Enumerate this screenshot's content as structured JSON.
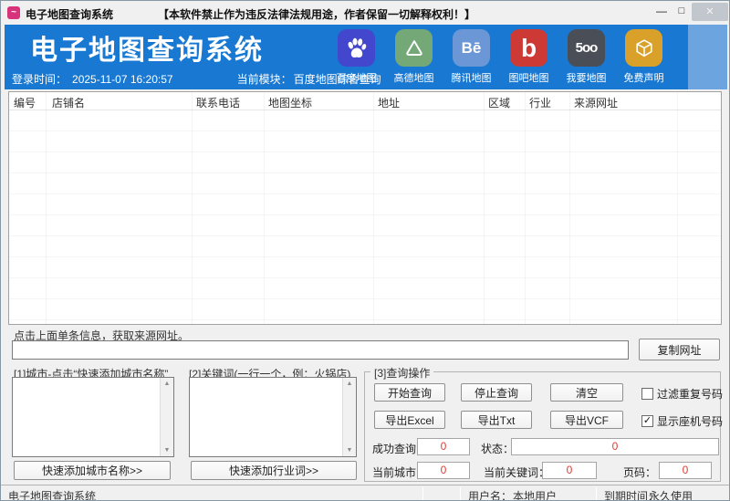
{
  "titlebar": {
    "title": "电子地图查询系统",
    "warning": "【本软件禁止作为违反法律法规用途，作者保留一切解释权利！】",
    "minimize": "—",
    "maximize": "□",
    "close": "✕"
  },
  "header": {
    "app_title": "电子地图查询系统",
    "login_time_label": "登录时间：",
    "login_time_value": "2025-11-07 16:20:57",
    "module_label": "当前模块：",
    "module_value": "百度地图综合查询",
    "shortcuts": [
      {
        "icon": "baidu-paw-icon",
        "label": "百度地图",
        "glyph": "",
        "color": "#4247ce"
      },
      {
        "icon": "mountain-icon",
        "label": "高德地图",
        "glyph": "",
        "color": "#74a877"
      },
      {
        "icon": "behance-icon",
        "label": "腾讯地图",
        "glyph": "Bē",
        "color": "#6b97d6"
      },
      {
        "icon": "letter-b-icon",
        "label": "图吧地图",
        "glyph": "b",
        "color": "#cd3a35"
      },
      {
        "icon": "500px-icon",
        "label": "我要地图",
        "glyph": "5oo",
        "color": "#4a4e56"
      },
      {
        "icon": "cube-icon",
        "label": "免费声明",
        "glyph": "",
        "color": "#d9a02a"
      }
    ]
  },
  "table": {
    "columns": [
      {
        "label": "编号"
      },
      {
        "label": "店铺名"
      },
      {
        "label": "联系电话"
      },
      {
        "label": "地图坐标"
      },
      {
        "label": "地址"
      },
      {
        "label": "区域"
      },
      {
        "label": "行业"
      },
      {
        "label": "来源网址"
      }
    ]
  },
  "url_section": {
    "hint": "点击上面单条信息，获取来源网址。",
    "url_value": "",
    "copy_button": "复制网址"
  },
  "city_panel": {
    "title": "[1]城市-点击“快速添加城市名称”",
    "list_value": "",
    "add_button": "快速添加城市名称>>"
  },
  "keyword_panel": {
    "title": "[2]关键词(一行一个，例：火锅店)",
    "list_value": "",
    "add_button": "快速添加行业词>>"
  },
  "query_panel": {
    "title": "[3]查询操作",
    "start_button": "开始查询",
    "stop_button": "停止查询",
    "clear_button": "清空",
    "export_excel_button": "导出Excel",
    "export_txt_button": "导出Txt",
    "export_vcf_button": "导出VCF",
    "filter_checkbox": {
      "label": "过滤重复号码",
      "checked": false,
      "mark": ""
    },
    "landline_checkbox": {
      "label": "显示座机号码",
      "checked": true,
      "mark": "✓"
    },
    "stats": {
      "success_label": "成功查询：",
      "success_value": "0",
      "status_label": "状态：",
      "status_value": "0",
      "city_label": "当前城市：",
      "city_value": "0",
      "keyword_label": "当前关键词：",
      "keyword_value": "0",
      "page_label": "页码：",
      "page_value": "0"
    }
  },
  "statusbar": {
    "app_name": "电子地图查询系统",
    "username_label": "用户名：",
    "username_value": "本地用户",
    "expire_label": "到期时间：",
    "expire_value": "永久使用"
  }
}
